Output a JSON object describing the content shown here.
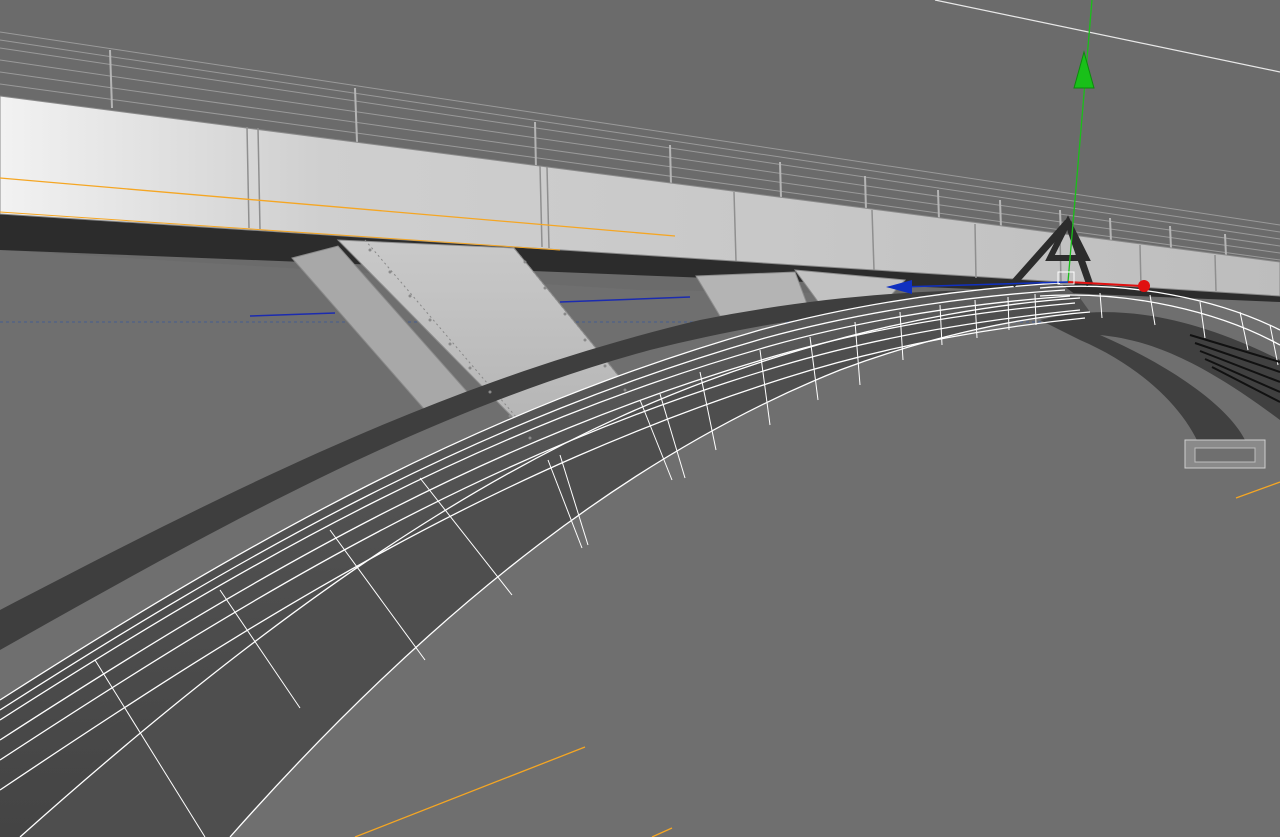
{
  "viewport": {
    "background": "#6a6a6a",
    "selection_wire_color": "#ffffff",
    "guide_line_color": "#ff9a1a"
  },
  "gizmo": {
    "y_axis_color": "#19c019",
    "x_axis_color": "#e01010",
    "z_axis_color": "#1030c0",
    "y_axis_icon": "arrow-up-icon",
    "x_axis_icon": "sphere-handle-icon",
    "z_axis_icon": "arrow-left-icon"
  },
  "objects": {
    "deck": "bridge-deck",
    "railing": "bridge-railing",
    "struts": "support-struts",
    "arch": "arch-rib-selected"
  }
}
